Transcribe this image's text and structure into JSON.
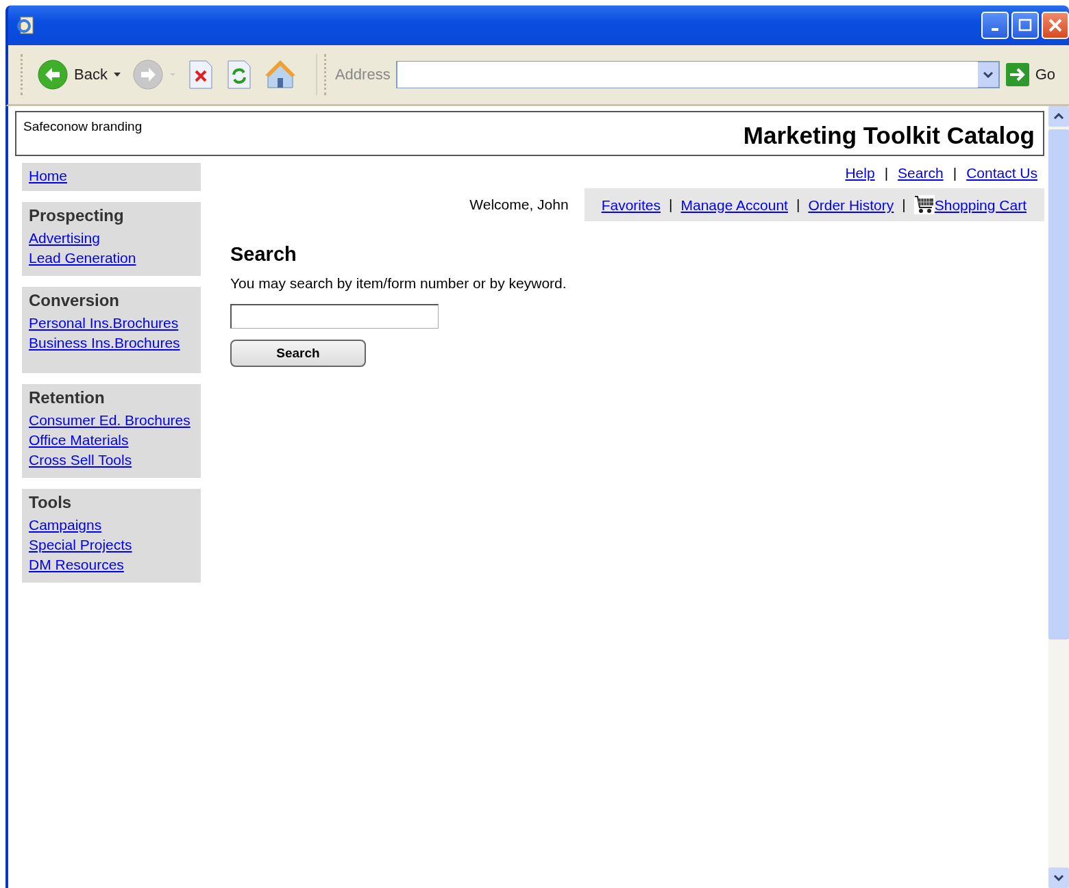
{
  "browser": {
    "back_label": "Back",
    "address_label": "Address",
    "go_label": "Go"
  },
  "header": {
    "branding": "Safeconow branding",
    "title": "Marketing Toolkit Catalog"
  },
  "sidebar": [
    {
      "links": [
        "Home"
      ]
    },
    {
      "heading": "Prospecting",
      "links": [
        "Advertising",
        "Lead Generation"
      ]
    },
    {
      "heading": "Conversion",
      "links": [
        "Personal Ins.Brochures",
        "Business Ins.Brochures"
      ]
    },
    {
      "heading": "Retention",
      "links": [
        "Consumer Ed. Brochures",
        "Office Materials",
        "Cross Sell Tools"
      ]
    },
    {
      "heading": "Tools",
      "links": [
        "Campaigns",
        "Special Projects",
        "DM Resources"
      ]
    }
  ],
  "utility_links": [
    {
      "kind": "link",
      "text": "Help"
    },
    {
      "kind": "separator",
      "text": "|"
    },
    {
      "kind": "link",
      "text": "Search"
    },
    {
      "kind": "separator",
      "text": "|"
    },
    {
      "kind": "link",
      "text": "Contact Us"
    }
  ],
  "welcome": "Welcome, John",
  "account_links": [
    {
      "kind": "link",
      "text": "Favorites"
    },
    {
      "kind": "separator",
      "text": "|"
    },
    {
      "kind": "link",
      "text": "Manage Account"
    },
    {
      "kind": "separator",
      "text": "|"
    },
    {
      "kind": "link",
      "text": "Order History"
    },
    {
      "kind": "separator",
      "text": "|"
    },
    {
      "kind": "cart",
      "text": "Shopping Cart"
    }
  ],
  "search": {
    "heading": "Search",
    "instructions": "You may search by item/form number or by keyword.",
    "button": "Search"
  }
}
